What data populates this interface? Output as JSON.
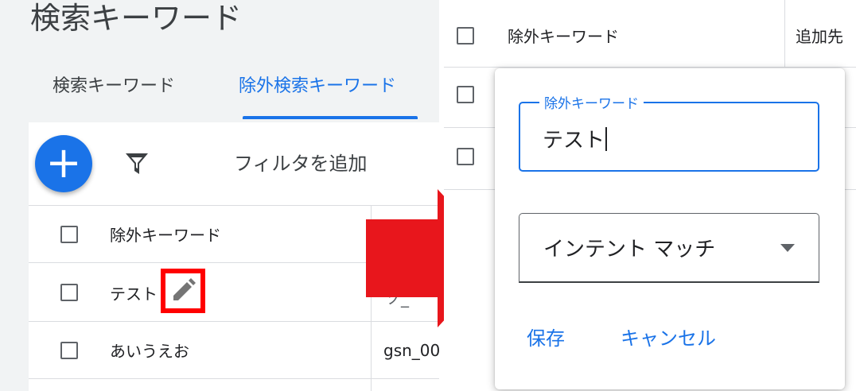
{
  "left": {
    "title": "検索キーワード",
    "tabs": [
      {
        "label": "検索キーワード",
        "active": false
      },
      {
        "label": "除外検索キーワード",
        "active": true
      }
    ],
    "toolbar": {
      "add_label": "+",
      "filter_label": "フィルタを追加"
    },
    "table": {
      "header": "除外キーワード",
      "rows": [
        {
          "keyword": "テスト",
          "col2": "ゾ_"
        },
        {
          "keyword": "あいうえお",
          "col2": "gsn_00"
        }
      ]
    }
  },
  "right": {
    "table": {
      "header": "除外キーワード",
      "col2_header": "追加先"
    },
    "popup": {
      "keyword_label": "除外キーワード",
      "keyword_value": "テスト",
      "match_type": "インテント マッチ",
      "save_label": "保存",
      "cancel_label": "キャンセル"
    }
  },
  "colors": {
    "accent": "#1a73e8",
    "highlight": "#ff0000",
    "arrow": "#e8161c"
  },
  "icons": [
    "plus-icon",
    "filter-icon",
    "pencil-icon",
    "arrow-right-icon",
    "dropdown-caret-icon"
  ]
}
